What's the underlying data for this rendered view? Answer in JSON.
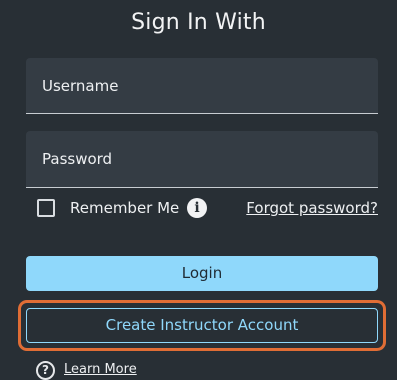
{
  "header": {
    "title": "Sign In With"
  },
  "form": {
    "username_placeholder": "Username",
    "password_placeholder": "Password",
    "remember_me_label": "Remember Me",
    "remember_me_checked": false,
    "info_icon_glyph": "i",
    "forgot_password_label": "Forgot password?",
    "login_label": "Login",
    "create_account_label": "Create Instructor Account"
  },
  "footer": {
    "help_icon_glyph": "?",
    "learn_more_label": "Learn More"
  },
  "colors": {
    "background": "#282f35",
    "field_background": "#343c44",
    "accent": "#8fd8fb",
    "highlight": "#e06d35"
  },
  "icons": {
    "info": "info-icon",
    "help": "help-icon",
    "checkbox": "checkbox-unchecked"
  }
}
